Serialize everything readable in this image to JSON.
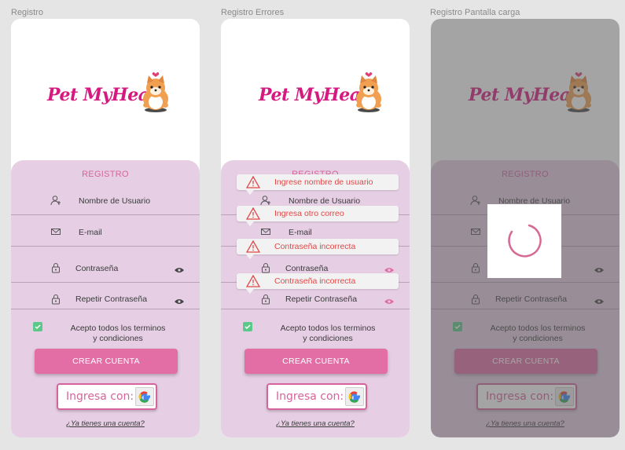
{
  "frames": [
    {
      "label": "Registro"
    },
    {
      "label": "Registro Errores"
    },
    {
      "label": "Registro  Pantalla carga"
    }
  ],
  "app": {
    "logo_text": "Pet MyHeart",
    "register_title": "REGISTRO",
    "fields": {
      "username": "Nombre de Usuario",
      "email": "E-mail",
      "password": "Contraseña",
      "repeat_password": "Repetir Contraseña"
    },
    "terms_line1": "Acepto todos los terminos",
    "terms_line2": "y condiciones",
    "terms_checked": true,
    "create_button": "CREAR CUENTA",
    "google_label": "Ingresa con:",
    "login_link": "¿Ya tienes una cuenta?"
  },
  "errors": {
    "username": "Ingrese nombre de usuario",
    "email": "Ingresa otro correo",
    "password": "Contraseña incorrecta",
    "repeat_password": "Contraseña incorrecta"
  },
  "colors": {
    "brand": "#d6197f",
    "accent": "#e26ea5",
    "panel": "#e6cfe4",
    "error": "#e04848",
    "check": "#5cc98a"
  },
  "icons": [
    "user-plus-icon",
    "mail-icon",
    "lock-icon",
    "eye-icon",
    "warning-icon",
    "google-icon",
    "check-icon",
    "spinner-icon"
  ]
}
